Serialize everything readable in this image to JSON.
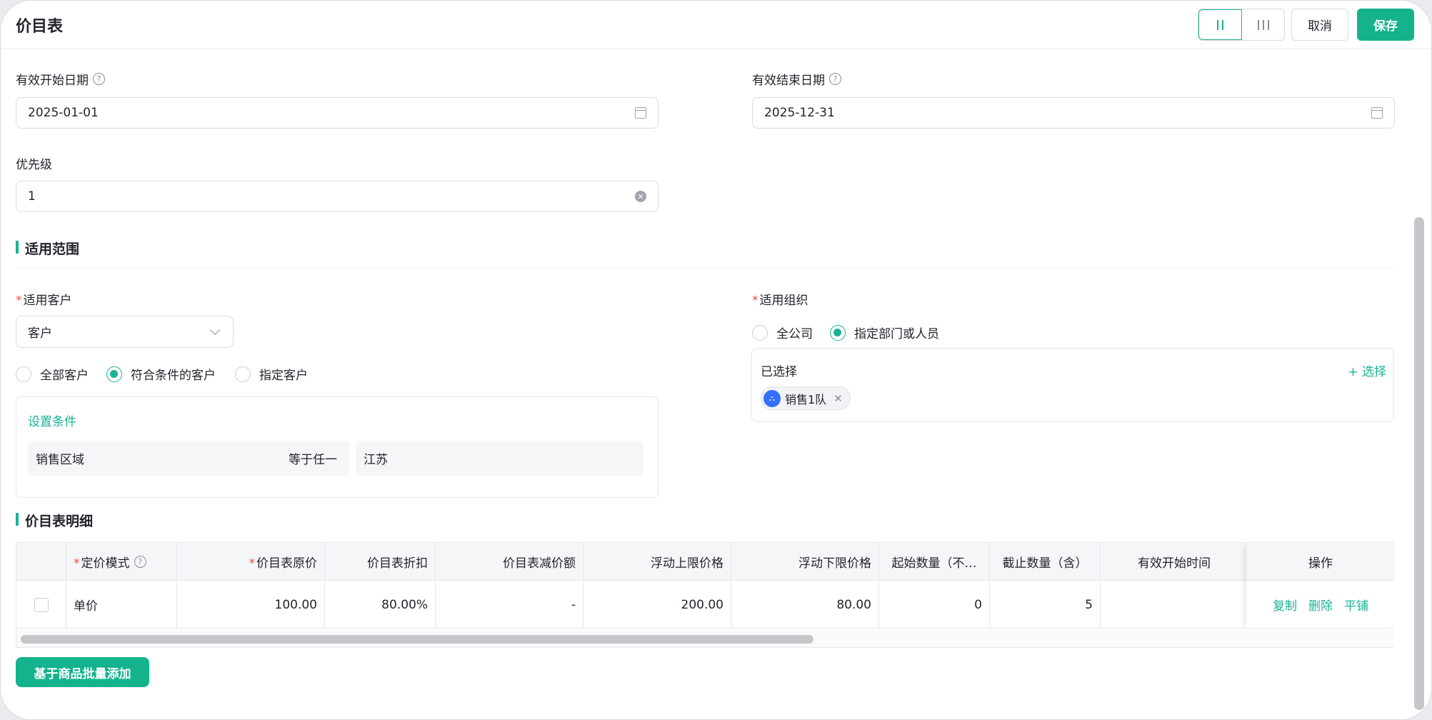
{
  "header": {
    "title": "价目表",
    "cancel_label": "取消",
    "save_label": "保存"
  },
  "form": {
    "start_date": {
      "label": "有效开始日期",
      "value": "2025-01-01"
    },
    "end_date": {
      "label": "有效结束日期",
      "value": "2025-12-31"
    },
    "priority": {
      "label": "优先级",
      "value": "1"
    }
  },
  "scope": {
    "title": "适用范围",
    "customer": {
      "label": "适用客户",
      "select_value": "客户",
      "options": [
        "全部客户",
        "符合条件的客户",
        "指定客户"
      ],
      "selected": "符合条件的客户",
      "condition": {
        "link": "设置条件",
        "field": "销售区域",
        "operator": "等于任一",
        "value": "江苏"
      }
    },
    "org": {
      "label": "适用组织",
      "options": [
        "全公司",
        "指定部门或人员"
      ],
      "selected": "指定部门或人员",
      "selected_label": "已选择",
      "add_label": "+ 选择",
      "tags": [
        "销售1队"
      ]
    }
  },
  "detail": {
    "title": "价目表明细",
    "columns": [
      "定价模式",
      "价目表原价",
      "价目表折扣",
      "价目表减价额",
      "浮动上限价格",
      "浮动下限价格",
      "起始数量（不…",
      "截止数量（含）",
      "有效开始时间",
      "操作"
    ],
    "rows": [
      {
        "mode": "单价",
        "price": "100.00",
        "discount": "80.00%",
        "reduce": "-",
        "upper": "200.00",
        "lower": "80.00",
        "start_qty": "0",
        "end_qty": "5",
        "start_time": "",
        "actions": [
          "复制",
          "删除",
          "平铺"
        ]
      }
    ],
    "batch_add_label": "基于商品批量添加"
  },
  "colors": {
    "accent": "#18b394",
    "button": "#14b38e",
    "required": "#f54a45"
  }
}
